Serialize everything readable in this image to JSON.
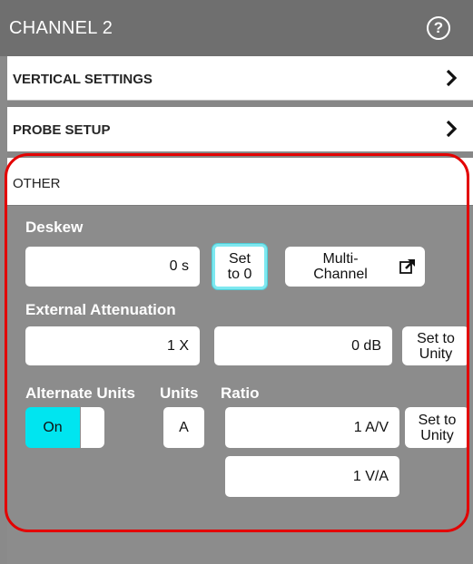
{
  "panel": {
    "title": "CHANNEL 2",
    "help_icon": "help-circle-icon"
  },
  "sections": {
    "vertical_settings": "VERTICAL SETTINGS",
    "probe_setup": "PROBE SETUP",
    "other": "OTHER"
  },
  "deskew": {
    "label": "Deskew",
    "value": "0 s",
    "set_zero_line1": "Set",
    "set_zero_line2": "to 0",
    "multichannel_line1": "Multi-",
    "multichannel_line2": "Channel",
    "multichannel_icon": "external-link-icon"
  },
  "external_attenuation": {
    "label": "External Attenuation",
    "value_x": "1 X",
    "value_db": "0 dB",
    "set_unity_line1": "Set to",
    "set_unity_line2": "Unity"
  },
  "alternate_units": {
    "label": "Alternate Units",
    "toggle_on": "On",
    "units_label": "Units",
    "units_value": "A",
    "ratio_label": "Ratio",
    "ratio_av": "1 A/V",
    "ratio_va": "1 V/A",
    "set_unity_line1": "Set to",
    "set_unity_line2": "Unity"
  },
  "colors": {
    "header_bg": "#6f6f6f",
    "panel_bg": "#8c8c8c",
    "toggle_on": "#00e5f0",
    "highlight_outline": "#e30000",
    "focus_ring": "#7ee8f0"
  }
}
